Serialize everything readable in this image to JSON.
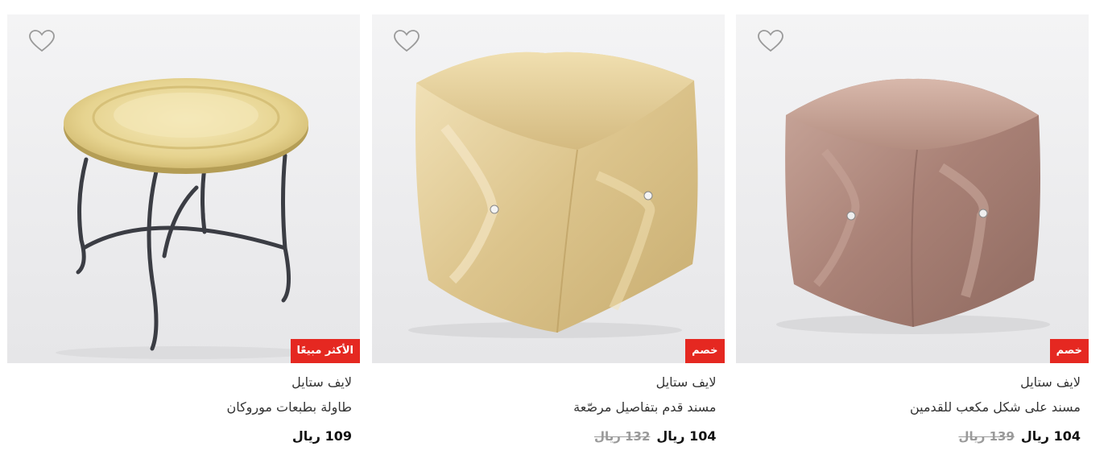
{
  "products": [
    {
      "brand": "لايف ستايل",
      "name": "مسند على شكل مكعب للقدمين",
      "price": "104 ريال",
      "old_price": "139 ريال",
      "badge": "خصم",
      "badge_color": "#e52821",
      "wishlist_icon": "heart-outline-icon"
    },
    {
      "brand": "لايف ستايل",
      "name": "مسند قدم بتفاصيل مرصّعة",
      "price": "104 ريال",
      "old_price": "132 ريال",
      "badge": "خصم",
      "badge_color": "#e52821",
      "wishlist_icon": "heart-outline-icon"
    },
    {
      "brand": "لايف ستايل",
      "name": "طاولة بطبعات موروكان",
      "price": "109 ريال",
      "badge": "الأكثر مبيعًا",
      "badge_color": "#e52821",
      "wishlist_icon": "heart-outline-icon"
    }
  ]
}
